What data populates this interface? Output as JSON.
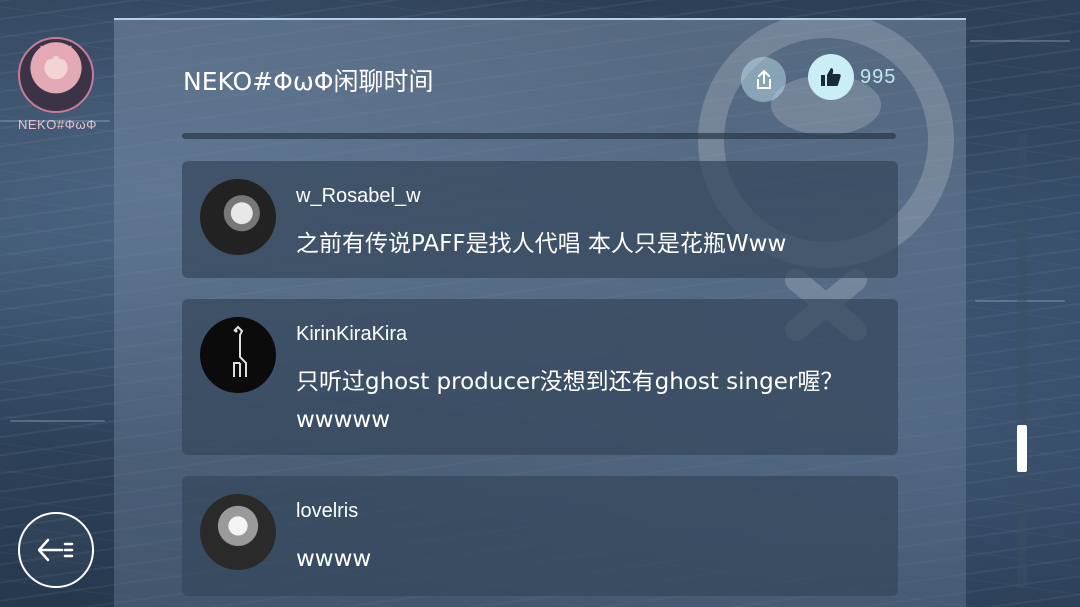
{
  "profile": {
    "name": "NEKO#ΦωΦ"
  },
  "header": {
    "title": "NEKO#ΦωΦ闲聊时间",
    "like_count": "995"
  },
  "icons": {
    "share": "share-icon",
    "like": "thumbs-up-icon",
    "back": "back-arrow-icon"
  },
  "comments": [
    {
      "username": "w_Rosabel_w",
      "message": "之前有传说PAFF是找人代唱 本人只是花瓶Www"
    },
    {
      "username": "KirinKiraKira",
      "message": "只听过ghost producer没想到还有ghost singer喔？ wwwww"
    },
    {
      "username": "lovelris",
      "message": "wwww"
    }
  ],
  "colors": {
    "accent": "#c9eef5",
    "profile_border": "#c77b9a"
  }
}
